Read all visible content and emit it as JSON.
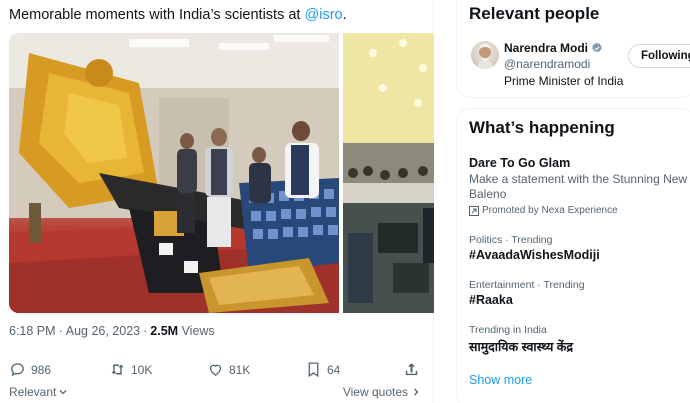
{
  "tweet": {
    "text_prefix": "Memorable moments with India’s scientists at ",
    "mention": "@isro",
    "text_suffix": ".",
    "time": "6:18 PM",
    "date": "Aug 26, 2023",
    "views_count": "2.5M",
    "views_label": "Views",
    "actions": {
      "replies": "986",
      "reposts": "10K",
      "likes": "81K",
      "bookmarks": "64"
    },
    "sort_label": "Relevant",
    "view_quotes_label": "View quotes"
  },
  "sidebar": {
    "relevant_people_title": "Relevant people",
    "person": {
      "name": "Narendra Modi",
      "handle": "@narendramodi",
      "bio": "Prime Minister of India",
      "follow_label": "Following"
    },
    "whats_happening_title": "What’s happening",
    "trends": [
      {
        "title": "Dare To Go Glam",
        "description": "Make a statement with the Stunning New Baleno",
        "promoted": "Promoted by Nexa Experience"
      },
      {
        "context": "Politics · Trending",
        "title": "#AvaadaWishesModiji"
      },
      {
        "context": "Entertainment · Trending",
        "title": "#Raaka"
      },
      {
        "context": "Trending in India",
        "title": "सामुदायिक स्वास्थ्य केंद्र"
      }
    ],
    "show_more": "Show more"
  },
  "icons": {
    "reply": "reply-icon",
    "repost": "repost-icon",
    "like": "heart-icon",
    "bookmark": "bookmark-icon",
    "share": "share-icon",
    "verified": "verified-badge-icon",
    "more": "more-dots-icon"
  },
  "colors": {
    "accent": "#1d9bf0",
    "text": "#0f1419",
    "secondary": "#536471",
    "verified": "#829aab"
  }
}
